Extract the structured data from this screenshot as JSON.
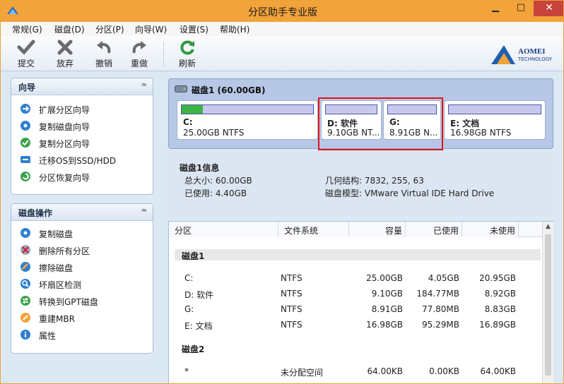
{
  "window": {
    "title": "分区助手专业版",
    "min_glyph": "▁",
    "max_glyph": "□",
    "close_glyph": "✕"
  },
  "menu": [
    "常规(G)",
    "磁盘(D)",
    "分区(P)",
    "向导(W)",
    "设置(S)",
    "帮助(H)"
  ],
  "toolbar": {
    "commit": "提交",
    "discard": "放弃",
    "undo": "撤销",
    "redo": "重做",
    "refresh": "刷新",
    "logo_line1": "AOMEI",
    "logo_line2": "TECHNOLOGY"
  },
  "wizard_panel": {
    "title": "向导",
    "collapse_glyph": "≈",
    "items": [
      "扩展分区向导",
      "复制磁盘向导",
      "复制分区向导",
      "迁移OS到SSD/HDD",
      "分区恢复向导"
    ]
  },
  "disk_ops_panel": {
    "title": "磁盘操作",
    "collapse_glyph": "≈",
    "items": [
      "复制磁盘",
      "删除所有分区",
      "擦除磁盘",
      "坏扇区检测",
      "转换到GPT磁盘",
      "重建MBR",
      "属性"
    ]
  },
  "disk_map": {
    "title": "磁盘1 (60.00GB)",
    "partitions": [
      {
        "name": "C:",
        "info": "25.00GB NTFS",
        "used_fraction": 0.162
      },
      {
        "name": "D: 软件",
        "info": "9.10GB NT...",
        "used_fraction": 0.0
      },
      {
        "name": "G:",
        "info": "8.91GB N...",
        "used_fraction": 0.0
      },
      {
        "name": "E: 文档",
        "info": "16.98GB NTFS",
        "used_fraction": 0.0
      }
    ]
  },
  "disk_info": {
    "title": "磁盘1信息",
    "total": "总大小: 60.00GB",
    "used": "已使用: 4.40GB",
    "geometry": "几何结构: 7832, 255, 63",
    "model": "磁盘模型: VMware Virtual IDE Hard Drive"
  },
  "table": {
    "headers": [
      "分区",
      "文件系统",
      "容量",
      "已使用",
      "未使用"
    ],
    "groups": [
      {
        "name": "磁盘1",
        "rows": [
          [
            "C:",
            "NTFS",
            "25.00GB",
            "4.05GB",
            "20.95GB"
          ],
          [
            "D: 软件",
            "NTFS",
            "9.10GB",
            "184.77MB",
            "8.92GB"
          ],
          [
            "G:",
            "NTFS",
            "8.91GB",
            "77.80MB",
            "8.83GB"
          ],
          [
            "E: 文档",
            "NTFS",
            "16.98GB",
            "95.29MB",
            "16.89GB"
          ]
        ]
      },
      {
        "name": "磁盘2",
        "rows": [
          [
            "*",
            "未分配空间",
            "64.00KB",
            "0.00KB",
            "64.00KB"
          ]
        ]
      }
    ],
    "scroll_up_glyph": "▲"
  },
  "colors": {
    "titlebar": "#f2a33a",
    "used_fill": "#3cb540",
    "partition_bar": "#c8c8ef",
    "highlight": "#e0141b"
  }
}
